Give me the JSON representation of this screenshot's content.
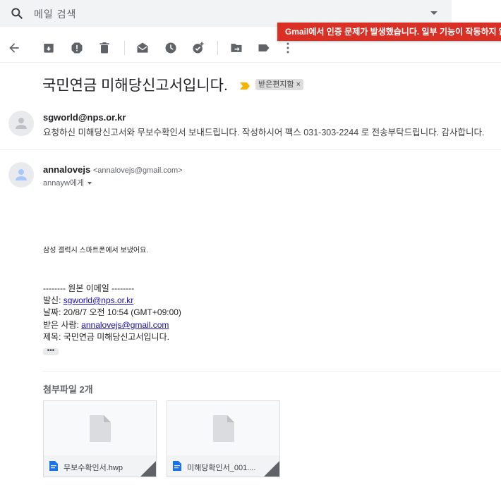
{
  "search": {
    "placeholder": "메일 검색"
  },
  "banner": {
    "text": "Gmail에서 인증 문제가 발생했습니다. 일부 기능이 작동하지 않을 수 있습니다."
  },
  "toolbar": {
    "icons": [
      "back-arrow-icon",
      "archive-icon",
      "report-spam-icon",
      "delete-icon",
      "mark-unread-icon",
      "snooze-icon",
      "add-task-icon",
      "move-to-icon",
      "labels-icon",
      "more-icon"
    ]
  },
  "thread": {
    "subject": "국민연금 미해당신고서입니다.",
    "label": "받은편지함",
    "label_close": "×"
  },
  "message1": {
    "sender": "sgworld@nps.or.kr",
    "snippet": "요청하신 미해당신고서와 무보수확인서 보내드립니다. 작성하시어 팩스 031-303-2244 로 전송부탁드립니다. 감사합니다."
  },
  "message2": {
    "sender_name": "annalovejs",
    "sender_email": "<annalovejs@gmail.com>",
    "to": "annayw에게",
    "mobile_sig": "삼성 갤럭시 스마트폰에서 보냈어요.",
    "orig_header": "-------- 원본 이메일 --------",
    "from_label": "발신: ",
    "from_value": "sgworld@nps.or.kr",
    "date_label": "날짜: ",
    "date_value": "20/8/7 오전 10:54 (GMT+09:00)",
    "recipient_label": "받은 사람: ",
    "recipient_value": "annalovejs@gmail.com",
    "subject_label": "제목: ",
    "subject_value": "국민연금 미해당신고서입니다.",
    "ellipsis": "•••"
  },
  "attachments": {
    "title": "첨부파일 2개",
    "files": [
      {
        "name": "무보수확인서.hwp"
      },
      {
        "name": "미해당확인서_001...."
      }
    ]
  },
  "colors": {
    "banner": "#d93025",
    "accent_blue": "#1a73e8",
    "importance": "#f4b400",
    "link": "#1a0dab"
  }
}
